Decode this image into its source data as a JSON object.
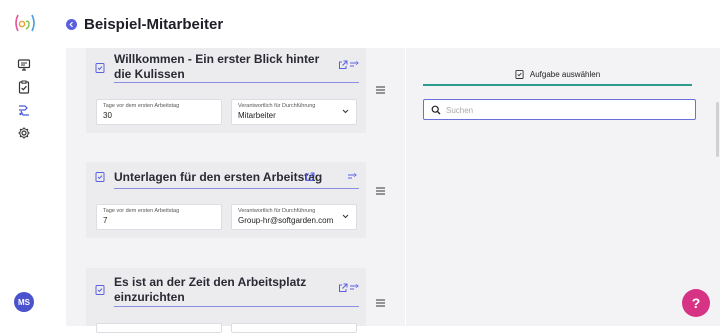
{
  "header": {
    "title": "Beispiel-Mitarbeiter"
  },
  "sidebar": {
    "items": [
      {
        "icon": "monitor-icon"
      },
      {
        "icon": "clipboard-check-icon"
      },
      {
        "icon": "workflow-icon",
        "active": true
      },
      {
        "icon": "gear-icon"
      }
    ],
    "avatar_initials": "MS"
  },
  "tasks": [
    {
      "title": "Willkommen - Ein erster Blick hinter die Kulissen",
      "field1_label": "Tage vor dem ersten Arbeitstag",
      "field1_value": "30",
      "field2_label": "Verantwortlich für Durchführung",
      "field2_value": "Mitarbeiter"
    },
    {
      "title": "Unterlagen für den ersten Arbeitstag",
      "field1_label": "Tage vor dem ersten Arbeitstag",
      "field1_value": "7",
      "field2_label": "Verantwortlich für Durchführung",
      "field2_value": "Group-hr@softgarden.com"
    },
    {
      "title": "Es ist an der Zeit den Arbeitsplatz einzurichten"
    }
  ],
  "right_panel": {
    "tab_label": "Aufgabe auswählen",
    "search_placeholder": "Suchen"
  },
  "help": {
    "label": "?"
  },
  "colors": {
    "accent": "#5a5fe0",
    "tab_underline": "#2a9d8f",
    "help": "#d63384",
    "avatar": "#4a52cc"
  }
}
